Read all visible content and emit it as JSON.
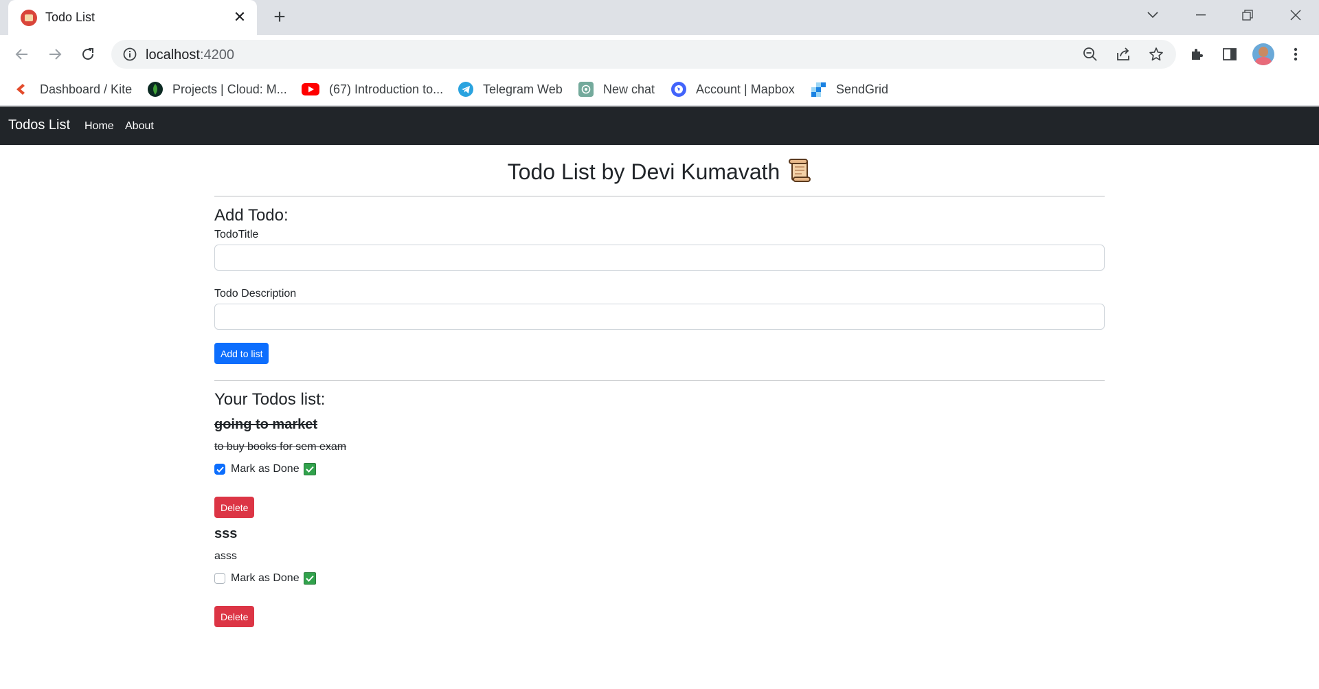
{
  "browser": {
    "tab_title": "Todo List",
    "url_host": "localhost",
    "url_port": ":4200",
    "bookmarks": [
      {
        "label": "Dashboard / Kite",
        "icon": "kite-icon"
      },
      {
        "label": "Projects | Cloud: M...",
        "icon": "mongodb-icon"
      },
      {
        "label": "(67) Introduction to...",
        "icon": "youtube-icon"
      },
      {
        "label": "Telegram Web",
        "icon": "telegram-icon"
      },
      {
        "label": "New chat",
        "icon": "openai-icon"
      },
      {
        "label": "Account | Mapbox",
        "icon": "mapbox-icon"
      },
      {
        "label": "SendGrid",
        "icon": "sendgrid-icon"
      }
    ]
  },
  "navbar": {
    "brand": "Todos List",
    "links": [
      "Home",
      "About"
    ]
  },
  "page": {
    "title": "Todo List by Devi Kumavath",
    "add_heading": "Add Todo:",
    "title_label": "TodoTitle",
    "title_value": "",
    "desc_label": "Todo Description",
    "desc_value": "",
    "add_button": "Add to list",
    "list_heading": "Your Todos list:",
    "mark_label": "Mark as Done",
    "delete_label": "Delete"
  },
  "todos": [
    {
      "title": "going to market",
      "desc": "to buy books for sem exam",
      "done": true
    },
    {
      "title": "sss",
      "desc": "asss",
      "done": false
    }
  ],
  "colors": {
    "navbar": "#212529",
    "primary": "#0d6efd",
    "danger": "#dc3545"
  }
}
